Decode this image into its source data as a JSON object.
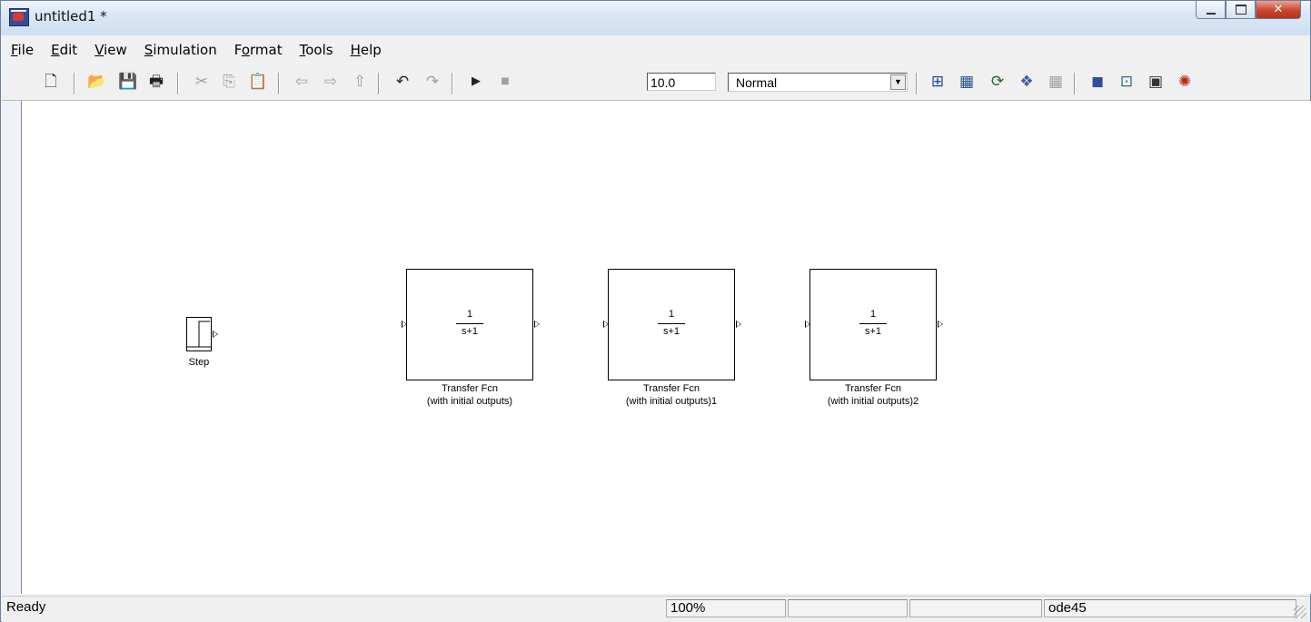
{
  "window": {
    "title": "untitled1 *"
  },
  "menu": [
    "File",
    "Edit",
    "View",
    "Simulation",
    "Format",
    "Tools",
    "Help"
  ],
  "toolbar": {
    "stop_time": "10.0",
    "sim_mode": "Normal",
    "icons": [
      "new-model-icon",
      "open-icon",
      "save-icon",
      "print-icon",
      "cut-icon",
      "copy-icon",
      "paste-icon",
      "back-icon",
      "forward-icon",
      "up-icon",
      "undo-icon",
      "redo-icon",
      "start-simulation-icon",
      "stop-simulation-icon",
      "build-icon",
      "update-diagram-icon",
      "refresh-icon",
      "library-browser-icon",
      "model-explorer-icon",
      "debug-icon",
      "debugger-icon",
      "model-advisor-icon",
      "property-icon",
      "profiler-icon"
    ]
  },
  "blocks": {
    "step": {
      "label": "Step"
    },
    "tf": [
      {
        "num": "1",
        "den": "s+1",
        "label1": "Transfer Fcn",
        "label2": "(with initial outputs)"
      },
      {
        "num": "1",
        "den": "s+1",
        "label1": "Transfer Fcn",
        "label2": "(with initial outputs)1"
      },
      {
        "num": "1",
        "den": "s+1",
        "label1": "Transfer Fcn",
        "label2": "(with initial outputs)2"
      }
    ]
  },
  "status": {
    "text": "Ready",
    "zoom": "100%",
    "solver": "ode45"
  }
}
